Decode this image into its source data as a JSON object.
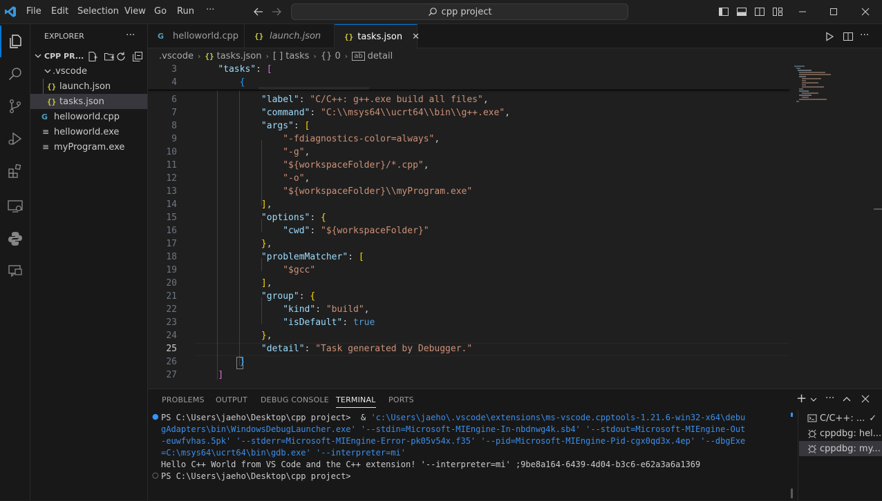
{
  "window": {
    "command_center": "cpp project",
    "menu": [
      "File",
      "Edit",
      "Selection",
      "View",
      "Go",
      "Run",
      "···"
    ]
  },
  "sidebar": {
    "title": "EXPLORER",
    "more": "···",
    "folder": "CPP PR...",
    "tree": [
      {
        "label": ".vscode",
        "icon": "chevron-down-icon",
        "depth": 1
      },
      {
        "label": "launch.json",
        "icon": "json-file-icon",
        "depth": 2
      },
      {
        "label": "tasks.json",
        "icon": "json-file-icon",
        "depth": 2,
        "selected": true
      },
      {
        "label": "helloworld.cpp",
        "icon": "cpp-file-icon",
        "depth": 1
      },
      {
        "label": "helloworld.exe",
        "icon": "exe-file-icon",
        "depth": 1
      },
      {
        "label": "myProgram.exe",
        "icon": "exe-file-icon",
        "depth": 1
      }
    ]
  },
  "tabs": [
    {
      "label": "helloworld.cpp",
      "icon": "cpp-file-icon"
    },
    {
      "label": "launch.json",
      "icon": "json-file-icon",
      "italic": true
    },
    {
      "label": "tasks.json",
      "icon": "json-file-icon",
      "active": true,
      "close": "✕"
    }
  ],
  "breadcrumb": {
    "items": [
      ".vscode",
      "tasks.json",
      "[ ] tasks",
      "{} 0",
      "detail"
    ]
  },
  "editor": {
    "lines": [
      {
        "n": "3",
        "tokens": [
          [
            "p",
            "    "
          ],
          [
            "k",
            "\"tasks\""
          ],
          [
            "p",
            ": "
          ],
          [
            "b1",
            "["
          ]
        ]
      },
      {
        "n": "4",
        "tokens": [
          [
            "p",
            "        "
          ],
          [
            "b2",
            "{"
          ]
        ]
      },
      {
        "n": "6",
        "tokens": [
          [
            "p",
            "            "
          ],
          [
            "k",
            "\"label\""
          ],
          [
            "p",
            ": "
          ],
          [
            "s",
            "\"C/C++: g++.exe build all files\""
          ],
          [
            "p",
            ","
          ]
        ]
      },
      {
        "n": "7",
        "tokens": [
          [
            "p",
            "            "
          ],
          [
            "k",
            "\"command\""
          ],
          [
            "p",
            ": "
          ],
          [
            "s",
            "\"C:\\\\msys64\\\\ucrt64\\\\bin\\\\g++.exe\""
          ],
          [
            "p",
            ","
          ]
        ]
      },
      {
        "n": "8",
        "tokens": [
          [
            "p",
            "            "
          ],
          [
            "k",
            "\"args\""
          ],
          [
            "p",
            ": "
          ],
          [
            "b3",
            "["
          ]
        ]
      },
      {
        "n": "9",
        "tokens": [
          [
            "p",
            "                "
          ],
          [
            "s",
            "\"-fdiagnostics-color=always\""
          ],
          [
            "p",
            ","
          ]
        ]
      },
      {
        "n": "10",
        "tokens": [
          [
            "p",
            "                "
          ],
          [
            "s",
            "\"-g\""
          ],
          [
            "p",
            ","
          ]
        ]
      },
      {
        "n": "11",
        "tokens": [
          [
            "p",
            "                "
          ],
          [
            "s",
            "\"${workspaceFolder}/*.cpp\""
          ],
          [
            "p",
            ","
          ]
        ]
      },
      {
        "n": "12",
        "tokens": [
          [
            "p",
            "                "
          ],
          [
            "s",
            "\"-o\""
          ],
          [
            "p",
            ","
          ]
        ]
      },
      {
        "n": "13",
        "tokens": [
          [
            "p",
            "                "
          ],
          [
            "s",
            "\"${workspaceFolder}\\\\myProgram.exe\""
          ]
        ]
      },
      {
        "n": "14",
        "tokens": [
          [
            "p",
            "            "
          ],
          [
            "b3",
            "]"
          ],
          [
            "p",
            ","
          ]
        ]
      },
      {
        "n": "15",
        "tokens": [
          [
            "p",
            "            "
          ],
          [
            "k",
            "\"options\""
          ],
          [
            "p",
            ": "
          ],
          [
            "b3",
            "{"
          ]
        ]
      },
      {
        "n": "16",
        "tokens": [
          [
            "p",
            "                "
          ],
          [
            "k",
            "\"cwd\""
          ],
          [
            "p",
            ": "
          ],
          [
            "s",
            "\"${workspaceFolder}\""
          ]
        ]
      },
      {
        "n": "17",
        "tokens": [
          [
            "p",
            "            "
          ],
          [
            "b3",
            "}"
          ],
          [
            "p",
            ","
          ]
        ]
      },
      {
        "n": "18",
        "tokens": [
          [
            "p",
            "            "
          ],
          [
            "k",
            "\"problemMatcher\""
          ],
          [
            "p",
            ": "
          ],
          [
            "b3",
            "["
          ]
        ]
      },
      {
        "n": "19",
        "tokens": [
          [
            "p",
            "                "
          ],
          [
            "s",
            "\"$gcc\""
          ]
        ]
      },
      {
        "n": "20",
        "tokens": [
          [
            "p",
            "            "
          ],
          [
            "b3",
            "]"
          ],
          [
            "p",
            ","
          ]
        ]
      },
      {
        "n": "21",
        "tokens": [
          [
            "p",
            "            "
          ],
          [
            "k",
            "\"group\""
          ],
          [
            "p",
            ": "
          ],
          [
            "b3",
            "{"
          ]
        ]
      },
      {
        "n": "22",
        "tokens": [
          [
            "p",
            "                "
          ],
          [
            "k",
            "\"kind\""
          ],
          [
            "p",
            ": "
          ],
          [
            "s",
            "\"build\""
          ],
          [
            "p",
            ","
          ]
        ]
      },
      {
        "n": "23",
        "tokens": [
          [
            "p",
            "                "
          ],
          [
            "k",
            "\"isDefault\""
          ],
          [
            "p",
            ": "
          ],
          [
            "bool",
            "true"
          ]
        ]
      },
      {
        "n": "24",
        "tokens": [
          [
            "p",
            "            "
          ],
          [
            "b3",
            "}"
          ],
          [
            "p",
            ","
          ]
        ]
      },
      {
        "n": "25",
        "tokens": [
          [
            "p",
            "            "
          ],
          [
            "k",
            "\"detail\""
          ],
          [
            "p",
            ": "
          ],
          [
            "s",
            "\"Task generated by Debugger.\""
          ]
        ],
        "current": true
      },
      {
        "n": "26",
        "tokens": [
          [
            "p",
            "        "
          ],
          [
            "b2",
            "}"
          ]
        ]
      },
      {
        "n": "27",
        "tokens": [
          [
            "p",
            "    "
          ],
          [
            "b1",
            "]"
          ]
        ]
      }
    ]
  },
  "panel": {
    "tabs": [
      "PROBLEMS",
      "OUTPUT",
      "DEBUG CONSOLE",
      "TERMINAL",
      "PORTS"
    ],
    "active_tab": "TERMINAL",
    "terminal": [
      {
        "marker": "●",
        "marker_color": "#3794ff",
        "text": "PS C:\\Users\\jaeho\\Desktop\\cpp project>  & ",
        "rest": "'c:\\Users\\jaeho\\.vscode\\extensions\\ms-vscode.cpptools-1.21.6-win32-x64\\debu"
      },
      {
        "text": "",
        "rest": "gAdapters\\bin\\WindowsDebugLauncher.exe' '--stdin=Microsoft-MIEngine-In-nbdnwg4k.sb4' '--stdout=Microsoft-MIEngine-Out"
      },
      {
        "text": "",
        "rest": "-euwfvhas.5pk' '--stderr=Microsoft-MIEngine-Error-pk05v54x.f35' '--pid=Microsoft-MIEngine-Pid-cgx0qd3x.4ep' '--dbgExe"
      },
      {
        "text": "",
        "rest": "=C:\\msys64\\ucrt64\\bin\\gdb.exe' '--interpreter=mi'"
      },
      {
        "text": "Hello C++ World from VS Code and the C++ extension! '--interpreter=mi' ;9be8a164-6439-4d04-b3c6-e62a3a6a1369",
        "rest": ""
      },
      {
        "marker": "○",
        "marker_color": "#8a8a8a",
        "text": "PS C:\\Users\\jaeho\\Desktop\\cpp project>",
        "rest": ""
      }
    ],
    "terminal_list": [
      {
        "label": "C/C++: ...",
        "check": "✓"
      },
      {
        "label": "cppdbg: hel...",
        "icon": "debug-icon"
      },
      {
        "label": "cppdbg: my...",
        "icon": "debug-icon",
        "selected": true
      }
    ],
    "add": "+",
    "more": "···"
  }
}
